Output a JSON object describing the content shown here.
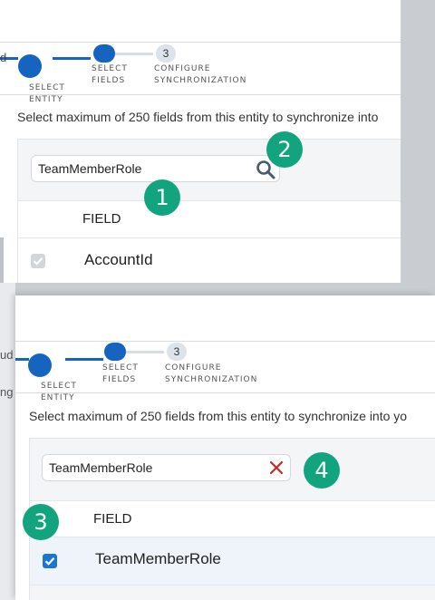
{
  "panel1": {
    "steps": [
      {
        "label_line1": "SELECT",
        "label_line2": "ENTITY"
      },
      {
        "label_line1": "SELECT",
        "label_line2": "FIELDS"
      },
      {
        "number": "3",
        "label_line1": "CONFIGURE",
        "label_line2": "SYNCHRONIZATION"
      }
    ],
    "instruction": "Select maximum of 250 fields from this entity to synchronize into",
    "search_value": "TeamMemberRole",
    "column_header": "FIELD",
    "rows": [
      {
        "name": "AccountId",
        "checked": true,
        "disabled": true
      }
    ],
    "badges": [
      "1",
      "2"
    ],
    "bg_fragment": "d"
  },
  "panel2": {
    "steps": [
      {
        "label_line1": "SELECT",
        "label_line2": "ENTITY"
      },
      {
        "label_line1": "SELECT",
        "label_line2": "FIELDS"
      },
      {
        "number": "3",
        "label_line1": "CONFIGURE",
        "label_line2": "SYNCHRONIZATION"
      }
    ],
    "instruction": "Select maximum of 250 fields from this entity to synchronize into yo",
    "search_value": "TeamMemberRole",
    "column_header": "FIELD",
    "rows": [
      {
        "name": "TeamMemberRole",
        "checked": true,
        "disabled": false
      }
    ],
    "badges": [
      "3",
      "4"
    ],
    "bg_fragments": [
      "ud",
      "ng"
    ]
  },
  "colors": {
    "accent": "#1565c0",
    "badge": "#12a47e",
    "clear": "#c62828"
  }
}
